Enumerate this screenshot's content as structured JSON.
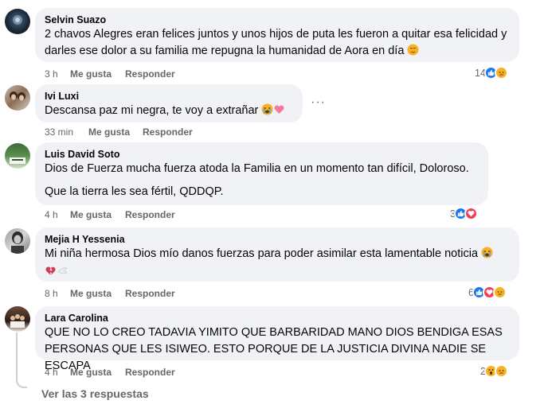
{
  "comments": [
    {
      "author": "Selvin Suazo",
      "lines": [
        "2 chavos Alegres eran felices juntos y unos hijos de puta les fueron a quitar esa felicidad y darles ese dolor a su familia me repugna la humanidad de Aora en día"
      ],
      "time": "3 h",
      "like": "Me gusta",
      "reply": "Responder",
      "reaction_count": "14"
    },
    {
      "author": "Ivi Luxi",
      "lines": [
        "Descansa paz mi negra, te voy a extrañar"
      ],
      "time": "33 min",
      "like": "Me gusta",
      "reply": "Responder",
      "more": "···"
    },
    {
      "author": "Luis David Soto",
      "lines": [
        "Dios de Fuerza mucha fuerza atoda la Familia en un momento tan difícil, Doloroso.",
        "Que la tierra les sea fértil, QDDQP."
      ],
      "time": "4 h",
      "like": "Me gusta",
      "reply": "Responder",
      "reaction_count": "3"
    },
    {
      "author": "Mejia H Yessenia",
      "lines": [
        "Mi niña hermosa Dios mío danos fuerzas para poder asimilar esta lamentable noticia"
      ],
      "time": "8 h",
      "like": "Me gusta",
      "reply": "Responder",
      "reaction_count": "6"
    },
    {
      "author": "Lara Carolina",
      "lines": [
        "QUE NO LO CREO TADAVIA YIMITO QUE BARBARIDAD MANO DIOS BENDIGA ESAS PERSONAS QUE LES ISIWEO. ESTO PORQUE DE LA JUSTICIA DIVINA NADIE SE ESCAPA"
      ],
      "time": "4 h",
      "like": "Me gusta",
      "reply": "Responder",
      "reaction_count": "2"
    }
  ],
  "view_replies": "Ver las 3 respuestas",
  "colors": {
    "bubble": "#f0f2f5",
    "meta": "#65676b",
    "like_blue": "#1877f2",
    "love_red": "#f33e58",
    "emoji_yellow": "#f7b125"
  },
  "icons": [
    "like-reaction-icon",
    "sad-reaction-icon",
    "love-reaction-icon",
    "wow-reaction-icon",
    "more-options-icon"
  ]
}
